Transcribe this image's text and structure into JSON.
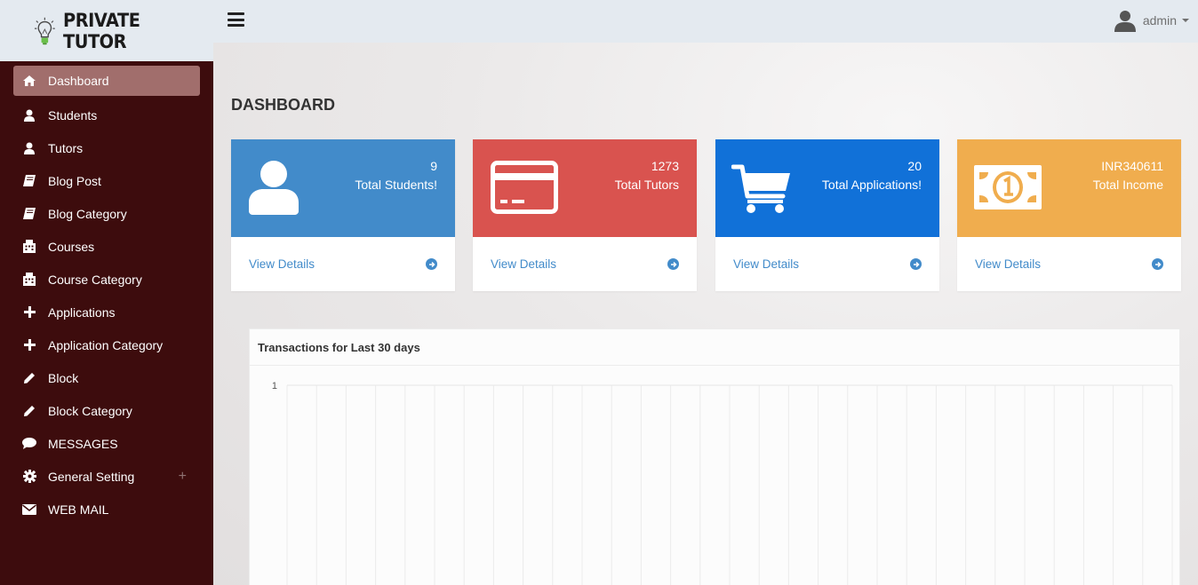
{
  "brand": {
    "name": "PRIVATE TUTOR"
  },
  "sidebar": {
    "items": [
      {
        "label": "Dashboard",
        "icon": "home-icon"
      },
      {
        "label": "Students",
        "icon": "user-icon"
      },
      {
        "label": "Tutors",
        "icon": "user-icon"
      },
      {
        "label": "Blog Post",
        "icon": "book-icon"
      },
      {
        "label": "Blog Category",
        "icon": "book-icon"
      },
      {
        "label": "Courses",
        "icon": "building-icon"
      },
      {
        "label": "Course Category",
        "icon": "building-icon"
      },
      {
        "label": "Applications",
        "icon": "plus-icon"
      },
      {
        "label": "Application Category",
        "icon": "plus-icon"
      },
      {
        "label": "Block",
        "icon": "pencil-icon"
      },
      {
        "label": "Block Category",
        "icon": "pencil-icon"
      },
      {
        "label": "MESSAGES",
        "icon": "comment-icon"
      },
      {
        "label": "General Setting",
        "icon": "gear-icon",
        "expand": "+"
      },
      {
        "label": "WEB MAIL",
        "icon": "envelope-icon"
      }
    ]
  },
  "topbar": {
    "username": "admin"
  },
  "page": {
    "title": "DASHBOARD"
  },
  "cards": [
    {
      "count": "9",
      "label": "Total Students!",
      "link": "View Details",
      "color": "#428bca",
      "icon": "user-icon"
    },
    {
      "count": "1273",
      "label": "Total Tutors",
      "link": "View Details",
      "color": "#d9534f",
      "icon": "credit-card-icon"
    },
    {
      "count": "20",
      "label": "Total Applications!",
      "link": "View Details",
      "color": "#1171d8",
      "icon": "shopping-cart-icon"
    },
    {
      "count": "INR340611",
      "label": "Total Income",
      "link": "View Details",
      "color": "#f0ad4e",
      "icon": "money-icon"
    }
  ],
  "panel": {
    "title": "Transactions for Last 30 days"
  },
  "chart_data": {
    "type": "line",
    "title": "Transactions for Last 30 days",
    "y_tick_labels": [
      "1"
    ],
    "ylim": [
      0,
      1
    ],
    "vertical_grid_lines": 30,
    "grid": true,
    "series": []
  }
}
